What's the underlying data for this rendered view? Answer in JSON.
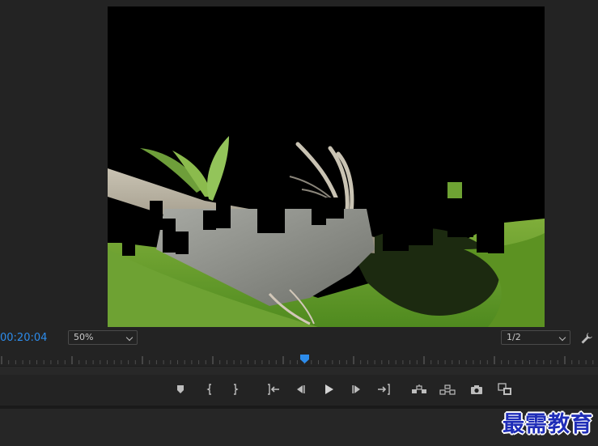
{
  "monitor": {
    "timecode": "00:20:04",
    "zoom_level": "50%",
    "playback_resolution": "1/2",
    "playhead_fraction": 0.509
  },
  "transport": {
    "buttons": [
      {
        "name": "add-marker-button",
        "icon": "marker-icon"
      },
      {
        "name": "mark-in-button",
        "icon": "mark-in-icon"
      },
      {
        "name": "mark-out-button",
        "icon": "mark-out-icon"
      },
      {
        "name": "go-to-in-button",
        "icon": "go-to-in-icon"
      },
      {
        "name": "step-back-button",
        "icon": "step-back-icon"
      },
      {
        "name": "play-button",
        "icon": "play-icon"
      },
      {
        "name": "step-forward-button",
        "icon": "step-forward-icon"
      },
      {
        "name": "go-to-out-button",
        "icon": "go-to-out-icon"
      },
      {
        "name": "lift-button",
        "icon": "lift-icon"
      },
      {
        "name": "extract-button",
        "icon": "extract-icon"
      },
      {
        "name": "export-frame-button",
        "icon": "camera-icon"
      },
      {
        "name": "comparison-view-button",
        "icon": "comparison-icon"
      }
    ]
  },
  "colors": {
    "timecode": "#2d8ceb",
    "playhead": "#2d8ceb",
    "panel_bg": "#232323",
    "watermark": "#1f2db8"
  },
  "watermark": {
    "text": "最需教育"
  }
}
